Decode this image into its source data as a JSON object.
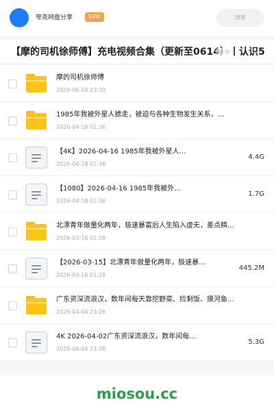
{
  "header": {
    "username": "夸克网盘分享",
    "badge": "SVIP",
    "search_label": "搜索"
  },
  "share": {
    "title": "【摩的司机徐师傅】充电视频合集（更新至0614）丨认识5",
    "title_info": "保 存"
  },
  "files": [
    {
      "name": "摩的司机徐师傅",
      "date": "2026-06-18 23:30",
      "size": "",
      "type": "folder"
    },
    {
      "name": "1985年我被外星人掳走，被迫与各种生物发生关系，…",
      "date": "2026-04-18 01:36",
      "size": "",
      "type": "folder"
    },
    {
      "name": "【4K】2026-04-16 1985年我被外星人…",
      "date": "2026-04-18 01:36",
      "size": "4.4G",
      "type": "file"
    },
    {
      "name": "【1080】2026-04-16 1985年我被外…",
      "date": "2026-04-18 01:36",
      "size": "1.7G",
      "type": "file"
    },
    {
      "name": "北漂青年做量化两年，极速暴富后人生陷入虚无，差点精…",
      "date": "2026-03-16 01:28",
      "size": "",
      "type": "folder"
    },
    {
      "name": "【2026-03-15】北漂青年做量化两年，极速暴…",
      "date": "2026-03-16 01:28",
      "size": "445.2M",
      "type": "file"
    },
    {
      "name": "广东资深流浪汉，数年间每天靠挖野菜、捡剩饭、摸河鱼…",
      "date": "2026-04-04 23:26",
      "size": "",
      "type": "folder"
    },
    {
      "name": "4K 2026-04-02广东资深流浪汉，数年间每…",
      "date": "2026-04-04 23:26",
      "size": "5.3G",
      "type": "file"
    }
  ],
  "footer": {
    "brand": "miosou.cc"
  },
  "colors": {
    "avatar": "#1e7cf5",
    "badge": "#f6a14a",
    "folder": "#fcc419",
    "brand": "#2f9e44"
  },
  "icons": {
    "folder": "folder-icon",
    "file": "document-icon"
  }
}
